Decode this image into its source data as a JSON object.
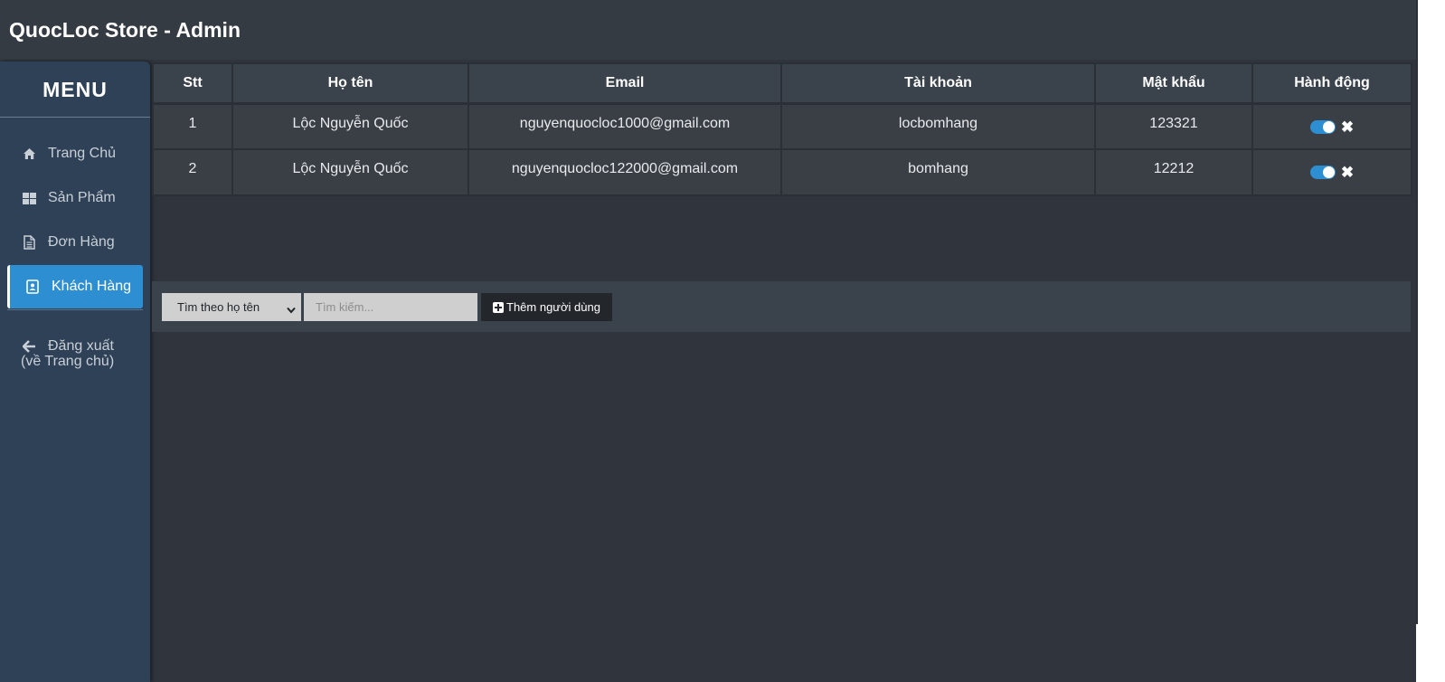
{
  "app": {
    "title": "QuocLoc Store - Admin"
  },
  "sidebar": {
    "menu_title": "MENU",
    "items": [
      {
        "label": "Trang Chủ",
        "icon": "home-icon",
        "active": false
      },
      {
        "label": "Sản Phẩm",
        "icon": "grid-icon",
        "active": false
      },
      {
        "label": "Đơn Hàng",
        "icon": "document-icon",
        "active": false
      },
      {
        "label": "Khách Hàng",
        "icon": "address-book-icon",
        "active": true
      }
    ],
    "logout": {
      "line1": "Đăng xuất",
      "line2": "(về Trang chủ)",
      "icon": "arrow-left-icon"
    }
  },
  "table": {
    "headers": [
      "Stt",
      "Họ tên",
      "Email",
      "Tài khoản",
      "Mật khẩu",
      "Hành động"
    ],
    "rows": [
      {
        "stt": "1",
        "name": "Lộc Nguyễn Quốc",
        "email": "nguyenquocloc1000@gmail.com",
        "account": "locbomhang",
        "password": "123321",
        "enabled": true
      },
      {
        "stt": "2",
        "name": "Lộc Nguyễn Quốc",
        "email": "nguyenquocloc122000@gmail.com",
        "account": "bomhang",
        "password": "12212",
        "enabled": true
      }
    ]
  },
  "toolbar": {
    "filter_selected": "Tìm theo họ tên",
    "search_placeholder": "Tìm kiếm...",
    "add_label": "Thêm người dùng"
  },
  "colors": {
    "accent": "#2d8fd2",
    "sidebar_bg": "#2f4157",
    "header_bg": "#353b43",
    "page_bg": "#30343c"
  }
}
